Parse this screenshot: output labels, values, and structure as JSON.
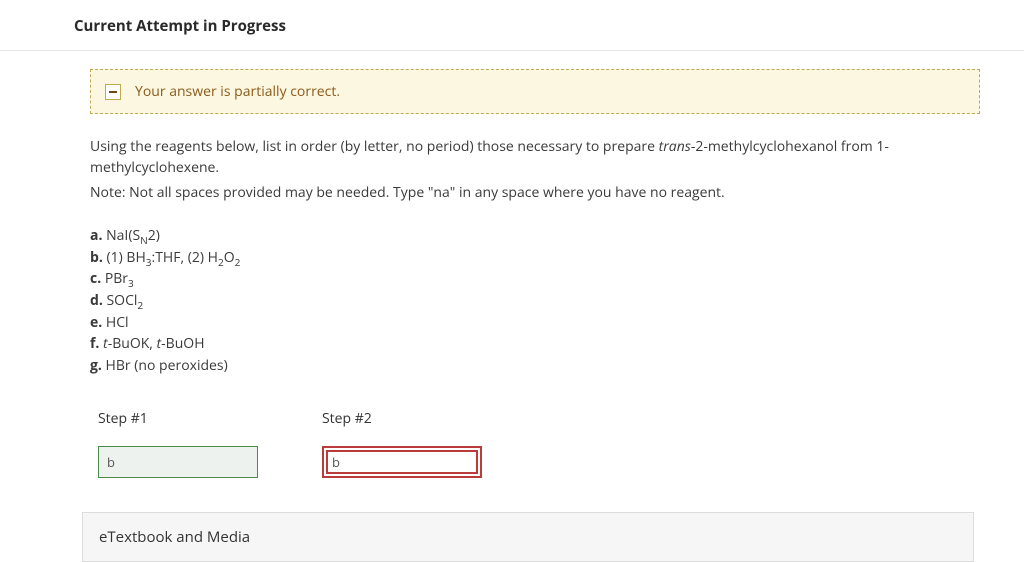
{
  "header": {
    "title": "Current Attempt in Progress"
  },
  "alert": {
    "message": "Your answer is partially correct."
  },
  "question": {
    "line1_pre": "Using the reagents below, list in order (by letter, no period) those necessary to prepare ",
    "line1_ital": "trans",
    "line1_post": "-2-methylcyclohexanol from 1-methylcyclohexene.",
    "line2": "Note: Not all spaces provided may be needed. Type \"na\" in any space where you have no reagent."
  },
  "reagents": {
    "a": {
      "lbl": "a.",
      "text_pre": " NaI(S",
      "sub1": "N",
      "text_post": "2)"
    },
    "b": {
      "lbl": "b.",
      "text_pre": " (1) BH",
      "sub1": "3",
      "mid1": ":THF, (2) H",
      "sub2": "2",
      "mid2": "O",
      "sub3": "2"
    },
    "c": {
      "lbl": "c.",
      "text_pre": " PBr",
      "sub1": "3"
    },
    "d": {
      "lbl": "d.",
      "text_pre": " SOCl",
      "sub1": "2"
    },
    "e": {
      "lbl": "e.",
      "text_pre": " HCl"
    },
    "f": {
      "lbl": "f.",
      "ital1": " t",
      "mid1": "-BuOK, ",
      "ital2": "t",
      "mid2": "-BuOH"
    },
    "g": {
      "lbl": "g.",
      "text_pre": " HBr (no peroxides)"
    }
  },
  "steps": {
    "s1": {
      "label": "Step #1",
      "value": "b"
    },
    "s2": {
      "label": "Step #2",
      "value": "b"
    }
  },
  "accordion": {
    "label": "eTextbook and Media"
  }
}
